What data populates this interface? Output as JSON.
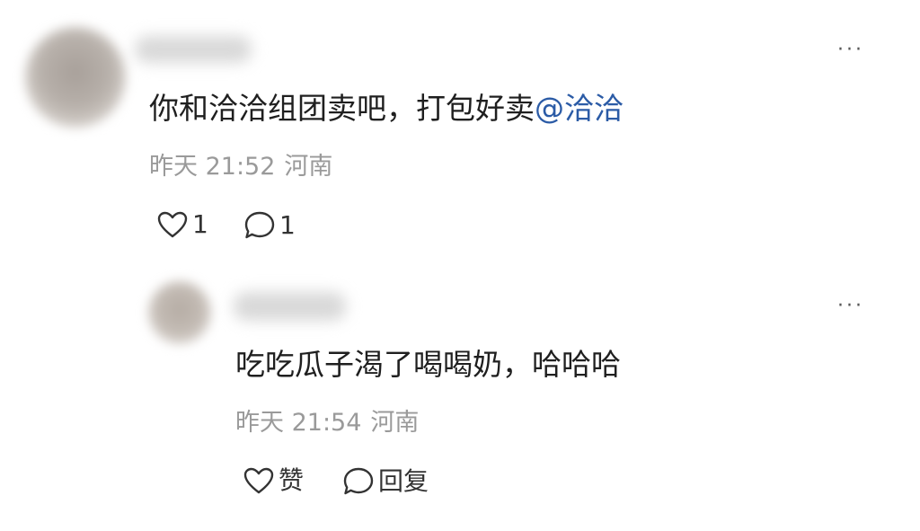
{
  "comment": {
    "text": "你和洽洽组团卖吧，打包好卖",
    "mention": "@洽洽",
    "time": "昨天 21:52",
    "location": "河南",
    "like_count": "1",
    "reply_count": "1",
    "more_label": "···"
  },
  "reply": {
    "text": "吃吃瓜子渴了喝喝奶，哈哈哈",
    "time": "昨天 21:54",
    "location": "河南",
    "like_label": "赞",
    "reply_label": "回复",
    "more_label": "···"
  },
  "colors": {
    "mention": "#2b5ba6",
    "meta": "#9a9a9a",
    "text": "#1f1f1f"
  },
  "icons": [
    "heart-icon",
    "comment-bubble-icon",
    "more-icon"
  ]
}
